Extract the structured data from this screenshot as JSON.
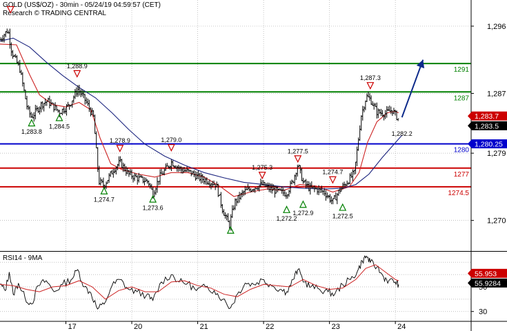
{
  "header": {
    "title": "GOLD (US$/OZ) - 30min - 05/24/19 04:59:57 (CET)",
    "source": "Research © TRADING CENTRAL"
  },
  "colors": {
    "support": "#cc0000",
    "resistance": "#008000",
    "pivot": "#0000cc",
    "ma_red": "#cc2222",
    "ma_blue": "#1a237e",
    "candles": "#000000",
    "arrow": "#0d2a8a",
    "grid": "#aaaaaa"
  },
  "chart_data": [
    {
      "type": "candlestick",
      "title": "GOLD (US$/OZ) - 30min",
      "x_ticks": [
        {
          "label": "17",
          "x": 1.0
        },
        {
          "label": "20",
          "x": 2.0
        },
        {
          "label": "21",
          "x": 3.0
        },
        {
          "label": "22",
          "x": 4.0
        },
        {
          "label": "23",
          "x": 5.0
        },
        {
          "label": "24",
          "x": 6.0
        }
      ],
      "xlim": [
        0.0,
        7.15
      ],
      "ylim": [
        1266.0,
        1299.5
      ],
      "y_ticks": [
        {
          "value": 1296,
          "label": "1,296"
        },
        {
          "value": 1287,
          "label": "1,287"
        },
        {
          "value": 1279,
          "label": "1,279"
        },
        {
          "value": 1270,
          "label": "1,270"
        }
      ],
      "price_path": [
        [
          0.0,
          1294.2
        ],
        [
          0.12,
          1295.5
        ],
        [
          0.18,
          1292.5
        ],
        [
          0.3,
          1290.3
        ],
        [
          0.42,
          1284.8
        ],
        [
          0.48,
          1283.8
        ],
        [
          0.62,
          1285.5
        ],
        [
          0.72,
          1286.0
        ],
        [
          0.9,
          1284.5
        ],
        [
          1.05,
          1285.4
        ],
        [
          1.18,
          1287.6
        ],
        [
          1.3,
          1286.0
        ],
        [
          1.42,
          1283.8
        ],
        [
          1.5,
          1275.2
        ],
        [
          1.58,
          1274.7
        ],
        [
          1.72,
          1276.8
        ],
        [
          1.82,
          1277.8
        ],
        [
          1.95,
          1276.2
        ],
        [
          2.1,
          1275.6
        ],
        [
          2.25,
          1275.2
        ],
        [
          2.32,
          1273.6
        ],
        [
          2.42,
          1275.8
        ],
        [
          2.6,
          1277.8
        ],
        [
          2.75,
          1276.8
        ],
        [
          2.9,
          1276.4
        ],
        [
          3.0,
          1275.8
        ],
        [
          3.15,
          1275.3
        ],
        [
          3.28,
          1274.8
        ],
        [
          3.38,
          1271.4
        ],
        [
          3.48,
          1269.3
        ],
        [
          3.56,
          1272.4
        ],
        [
          3.7,
          1273.8
        ],
        [
          3.85,
          1274.4
        ],
        [
          3.98,
          1274.8
        ],
        [
          4.1,
          1274.2
        ],
        [
          4.25,
          1273.8
        ],
        [
          4.35,
          1273.6
        ],
        [
          4.45,
          1275.4
        ],
        [
          4.52,
          1277.5
        ],
        [
          4.6,
          1275.1
        ],
        [
          4.7,
          1274.3
        ],
        [
          4.8,
          1274.2
        ],
        [
          4.92,
          1273.8
        ],
        [
          5.05,
          1272.5
        ],
        [
          5.15,
          1274.0
        ],
        [
          5.28,
          1275.3
        ],
        [
          5.38,
          1276.4
        ],
        [
          5.48,
          1284.0
        ],
        [
          5.56,
          1286.6
        ],
        [
          5.62,
          1286.2
        ],
        [
          5.72,
          1284.5
        ],
        [
          5.85,
          1284.3
        ],
        [
          5.95,
          1284.8
        ],
        [
          6.05,
          1283.5
        ]
      ],
      "moving_averages": [
        {
          "color_key": "ma_red",
          "points": [
            [
              0.0,
              1293.6
            ],
            [
              0.25,
              1293.5
            ],
            [
              0.45,
              1289.5
            ],
            [
              0.6,
              1286.8
            ],
            [
              0.8,
              1285.5
            ],
            [
              1.0,
              1285.2
            ],
            [
              1.2,
              1285.8
            ],
            [
              1.38,
              1284.8
            ],
            [
              1.52,
              1281.0
            ],
            [
              1.68,
              1277.6
            ],
            [
              1.85,
              1276.8
            ],
            [
              2.1,
              1276.2
            ],
            [
              2.35,
              1275.8
            ],
            [
              2.6,
              1276.4
            ],
            [
              2.85,
              1276.4
            ],
            [
              3.1,
              1275.8
            ],
            [
              3.35,
              1274.5
            ],
            [
              3.55,
              1273.2
            ],
            [
              3.8,
              1273.8
            ],
            [
              4.05,
              1274.2
            ],
            [
              4.3,
              1274.0
            ],
            [
              4.55,
              1274.8
            ],
            [
              4.8,
              1274.6
            ],
            [
              5.05,
              1273.8
            ],
            [
              5.3,
              1274.5
            ],
            [
              5.45,
              1276.4
            ],
            [
              5.58,
              1280.5
            ],
            [
              5.72,
              1283.2
            ],
            [
              5.88,
              1284.4
            ],
            [
              6.0,
              1284.6
            ],
            [
              6.05,
              1284.4
            ]
          ]
        },
        {
          "color_key": "ma_blue",
          "points": [
            [
              0.0,
              1294.0
            ],
            [
              0.2,
              1294.4
            ],
            [
              0.45,
              1293.2
            ],
            [
              0.7,
              1291.2
            ],
            [
              0.95,
              1289.4
            ],
            [
              1.2,
              1287.8
            ],
            [
              1.45,
              1286.4
            ],
            [
              1.7,
              1284.4
            ],
            [
              1.95,
              1282.2
            ],
            [
              2.2,
              1280.2
            ],
            [
              2.5,
              1278.6
            ],
            [
              2.8,
              1277.4
            ],
            [
              3.1,
              1276.4
            ],
            [
              3.4,
              1275.7
            ],
            [
              3.7,
              1275.1
            ],
            [
              4.0,
              1274.8
            ],
            [
              4.3,
              1274.5
            ],
            [
              4.6,
              1274.3
            ],
            [
              4.9,
              1274.2
            ],
            [
              5.2,
              1274.3
            ],
            [
              5.4,
              1274.8
            ],
            [
              5.6,
              1276.2
            ],
            [
              5.8,
              1278.4
            ],
            [
              6.0,
              1280.4
            ],
            [
              6.1,
              1281.4
            ]
          ]
        }
      ],
      "levels": [
        {
          "value": 1291.0,
          "label": "1291",
          "role": "resistance"
        },
        {
          "value": 1287.2,
          "label": "1287",
          "role": "resistance"
        },
        {
          "value": 1280.25,
          "label": "1280",
          "role": "pivot"
        },
        {
          "value": 1277.0,
          "label": "1277",
          "role": "support"
        },
        {
          "value": 1274.5,
          "label": "1274.5",
          "role": "support"
        }
      ],
      "annotations": [
        {
          "label": "1,288.9",
          "x": 1.17,
          "y": 1288.9,
          "marker": "down"
        },
        {
          "label": "1,283.8",
          "x": 0.48,
          "y": 1283.8,
          "marker": "up"
        },
        {
          "label": "1,284.5",
          "x": 0.9,
          "y": 1284.5,
          "marker": "up"
        },
        {
          "label": "1,278.9",
          "x": 1.82,
          "y": 1278.9,
          "marker": "down"
        },
        {
          "label": "1,279.0",
          "x": 2.6,
          "y": 1279.0,
          "marker": "down"
        },
        {
          "label": "1,274.7",
          "x": 1.58,
          "y": 1274.7,
          "marker": "up"
        },
        {
          "label": "1,273.6",
          "x": 2.32,
          "y": 1273.6,
          "marker": "up"
        },
        {
          "label": "1,275.3",
          "x": 3.98,
          "y": 1275.3,
          "marker": "down"
        },
        {
          "label": "1,277.5",
          "x": 4.52,
          "y": 1277.5,
          "marker": "down"
        },
        {
          "label": "1,274.7",
          "x": 5.05,
          "y": 1274.7,
          "marker": "down"
        },
        {
          "label": "1,272.2",
          "x": 4.35,
          "y": 1272.2,
          "marker": "up"
        },
        {
          "label": "1,272.9",
          "x": 4.6,
          "y": 1272.9,
          "marker": "up"
        },
        {
          "label": "1,272.5",
          "x": 5.2,
          "y": 1272.5,
          "marker": "up"
        },
        {
          "label": "1,287.3",
          "x": 5.62,
          "y": 1287.3,
          "marker": "down"
        },
        {
          "label": "1,282.2",
          "x": 6.1,
          "y": 1281.6,
          "marker": "none"
        }
      ],
      "extra_markers": [
        {
          "x": 0.16,
          "y": 1298.2,
          "marker": "down"
        },
        {
          "x": 3.5,
          "y": 1268.7,
          "marker": "up"
        }
      ],
      "badges": [
        {
          "label": "1,283.7",
          "value": 1283.7,
          "bg": "#cc0000",
          "fg": "#ffffff"
        },
        {
          "label": "1,283.5",
          "value": 1283.5,
          "bg": "#000000",
          "fg": "#ffffff"
        },
        {
          "label": "1,280.25",
          "value": 1280.25,
          "bg": "#0000cc",
          "fg": "#ffffff"
        }
      ],
      "forecast_arrow": {
        "from": [
          6.1,
          1283.8
        ],
        "to": [
          6.42,
          1291.5
        ]
      },
      "current_price": 1283.5
    },
    {
      "type": "line",
      "title": "RSI14 - 9MA",
      "xlim": [
        0.0,
        7.15
      ],
      "ylim": [
        22,
        78
      ],
      "y_ticks": [
        {
          "value": 50,
          "label": "50"
        },
        {
          "value": 30,
          "label": "30"
        }
      ],
      "guide_lines": [
        70,
        60,
        40
      ],
      "series": [
        {
          "name": "RSI14",
          "color_key": "candles",
          "points": [
            [
              0.0,
              52
            ],
            [
              0.08,
              47
            ],
            [
              0.14,
              62
            ],
            [
              0.2,
              44
            ],
            [
              0.28,
              53
            ],
            [
              0.38,
              41
            ],
            [
              0.48,
              36
            ],
            [
              0.58,
              51
            ],
            [
              0.7,
              55
            ],
            [
              0.82,
              46
            ],
            [
              0.95,
              52
            ],
            [
              1.08,
              56
            ],
            [
              1.18,
              64
            ],
            [
              1.28,
              50
            ],
            [
              1.38,
              45
            ],
            [
              1.48,
              32
            ],
            [
              1.58,
              36
            ],
            [
              1.7,
              51
            ],
            [
              1.82,
              56
            ],
            [
              1.95,
              48
            ],
            [
              2.08,
              46
            ],
            [
              2.22,
              43
            ],
            [
              2.32,
              39
            ],
            [
              2.45,
              54
            ],
            [
              2.6,
              60
            ],
            [
              2.72,
              54
            ],
            [
              2.85,
              53
            ],
            [
              2.98,
              47
            ],
            [
              3.12,
              50
            ],
            [
              3.25,
              47
            ],
            [
              3.38,
              40
            ],
            [
              3.5,
              33
            ],
            [
              3.6,
              44
            ],
            [
              3.72,
              53
            ],
            [
              3.85,
              52
            ],
            [
              3.98,
              56
            ],
            [
              4.1,
              52
            ],
            [
              4.25,
              48
            ],
            [
              4.35,
              46
            ],
            [
              4.45,
              56
            ],
            [
              4.52,
              64
            ],
            [
              4.62,
              54
            ],
            [
              4.72,
              50
            ],
            [
              4.85,
              48
            ],
            [
              4.98,
              46
            ],
            [
              5.08,
              44
            ],
            [
              5.2,
              52
            ],
            [
              5.32,
              56
            ],
            [
              5.42,
              62
            ],
            [
              5.5,
              71
            ],
            [
              5.56,
              75
            ],
            [
              5.62,
              70
            ],
            [
              5.72,
              66
            ],
            [
              5.82,
              58
            ],
            [
              5.9,
              55
            ],
            [
              6.0,
              54
            ],
            [
              6.05,
              52
            ]
          ]
        },
        {
          "name": "9MA",
          "color_key": "ma_red",
          "points": [
            [
              0.0,
              52
            ],
            [
              0.2,
              51
            ],
            [
              0.4,
              48
            ],
            [
              0.6,
              46
            ],
            [
              0.8,
              50
            ],
            [
              1.0,
              51
            ],
            [
              1.2,
              55
            ],
            [
              1.4,
              50
            ],
            [
              1.6,
              40
            ],
            [
              1.8,
              47
            ],
            [
              2.0,
              50
            ],
            [
              2.2,
              46
            ],
            [
              2.4,
              46
            ],
            [
              2.6,
              54
            ],
            [
              2.8,
              55
            ],
            [
              3.0,
              51
            ],
            [
              3.2,
              49
            ],
            [
              3.4,
              44
            ],
            [
              3.6,
              42
            ],
            [
              3.8,
              48
            ],
            [
              4.0,
              52
            ],
            [
              4.2,
              51
            ],
            [
              4.4,
              50
            ],
            [
              4.6,
              56
            ],
            [
              4.8,
              51
            ],
            [
              5.0,
              48
            ],
            [
              5.2,
              49
            ],
            [
              5.4,
              56
            ],
            [
              5.55,
              65
            ],
            [
              5.7,
              68
            ],
            [
              5.85,
              62
            ],
            [
              6.0,
              56
            ],
            [
              6.05,
              55
            ]
          ]
        }
      ],
      "badges": [
        {
          "label": "55.953",
          "value": 55.953,
          "bg": "#cc0000",
          "fg": "#ffffff"
        },
        {
          "label": "55.9284",
          "value": 55.9284,
          "bg": "#000000",
          "fg": "#ffffff"
        }
      ]
    }
  ]
}
